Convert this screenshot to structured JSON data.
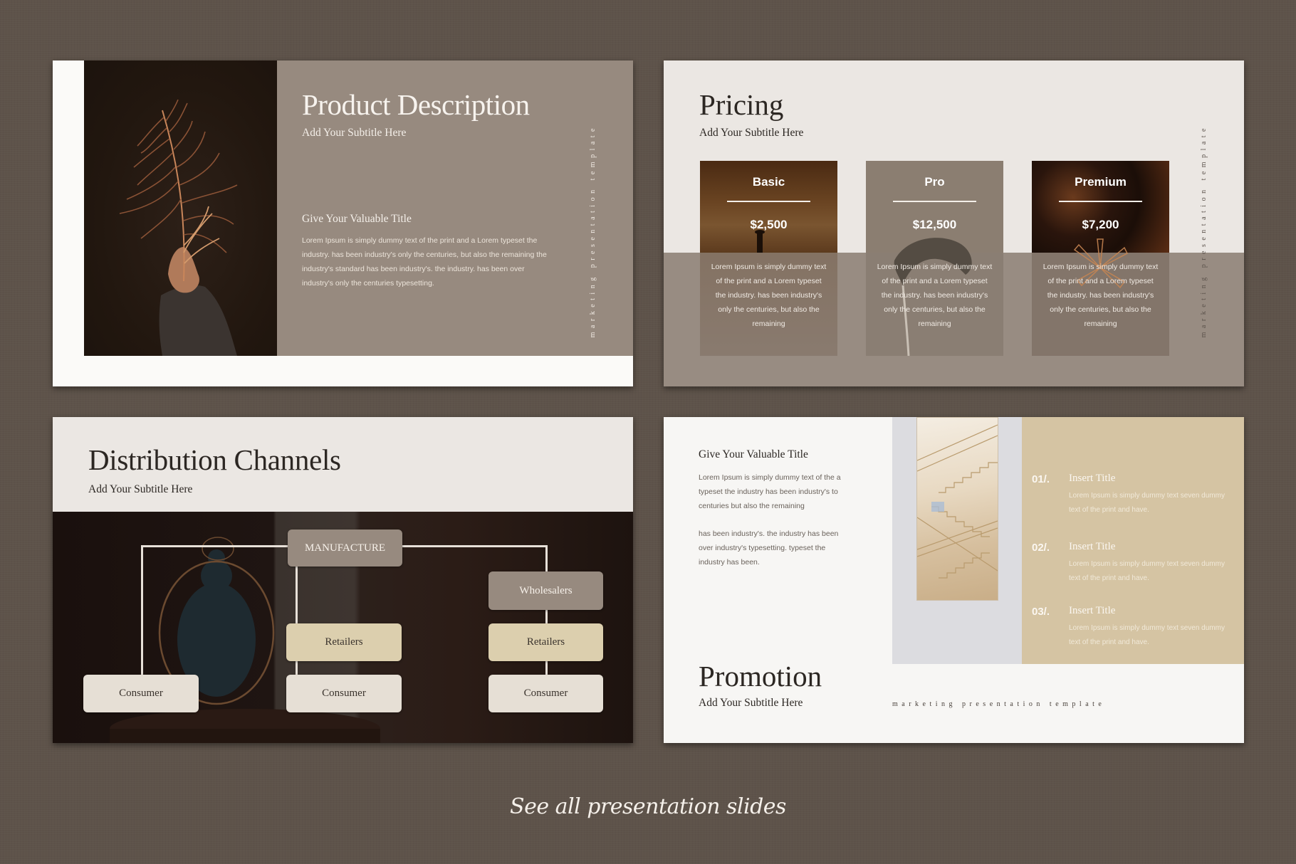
{
  "slides": {
    "product": {
      "title": "Product Description",
      "subtitle": "Add Your Subtitle Here",
      "section_title": "Give Your Valuable Title",
      "body": "Lorem Ipsum is simply dummy text of the print and  a Lorem typeset the industry. has been industry's only  the  centuries, but also the remaining the industry's standard has been industry's. the industry. has been over industry's only  the  centuries typesetting.",
      "vertical_tag": "marketing presentation template",
      "image_icon": "hand-holding-dried-leaf-photo"
    },
    "pricing": {
      "title": "Pricing",
      "subtitle": "Add Your Subtitle Here",
      "vertical_tag": "marketing presentation template",
      "plans": [
        {
          "name": "Basic",
          "price": "$2,500",
          "description": "Lorem Ipsum is simply dummy text of the print and  a Lorem typeset the industry. has been industry's only  the  centuries, but also the remaining"
        },
        {
          "name": "Pro",
          "price": "$12,500",
          "description": "Lorem Ipsum is simply dummy text of the print and  a Lorem typeset the industry. has been industry's only  the  centuries, but also the remaining"
        },
        {
          "name": "Premium",
          "price": "$7,200",
          "description": "Lorem Ipsum is simply dummy text of the print and  a Lorem typeset the industry. has been industry's only  the  centuries, but also the remaining"
        }
      ]
    },
    "distribution": {
      "title": "Distribution Channels",
      "subtitle": "Add Your Subtitle Here",
      "nodes": {
        "manufacture": "MANUFACTURE",
        "wholesalers": "Wholesalers",
        "retailers_center": "Retailers",
        "retailers_right": "Retailers",
        "consumer_left": "Consumer",
        "consumer_center": "Consumer",
        "consumer_right": "Consumer"
      }
    },
    "promotion": {
      "section_title": "Give Your Valuable Title",
      "paragraph_1": "Lorem Ipsum is simply dummy text of the a typeset the industry has been industry's to centuries but also the remaining",
      "paragraph_2": "has been industry's. the industry has been over industry's typesetting. typeset the industry has been.",
      "title": "Promotion",
      "subtitle": "Add Your Subtitle Here",
      "tagline": "marketing presentation template",
      "image_icon": "staircase-photo",
      "items": [
        {
          "number": "01/.",
          "title": "Insert Title",
          "description": "Lorem Ipsum is simply dummy text seven dummy text of the print and have."
        },
        {
          "number": "02/.",
          "title": "Insert Title",
          "description": "Lorem Ipsum is simply dummy text seven dummy text of the print and have."
        },
        {
          "number": "03/.",
          "title": "Insert Title",
          "description": "Lorem Ipsum is simply dummy text seven dummy text of the print and have."
        }
      ]
    }
  },
  "footer": {
    "link_label": "See all presentation slides"
  },
  "colors": {
    "background": "#5e534a",
    "taupe": "#978a7f",
    "cream": "#ebe7e3",
    "tan": "#d5c4a3",
    "dark": "#2c2723"
  }
}
